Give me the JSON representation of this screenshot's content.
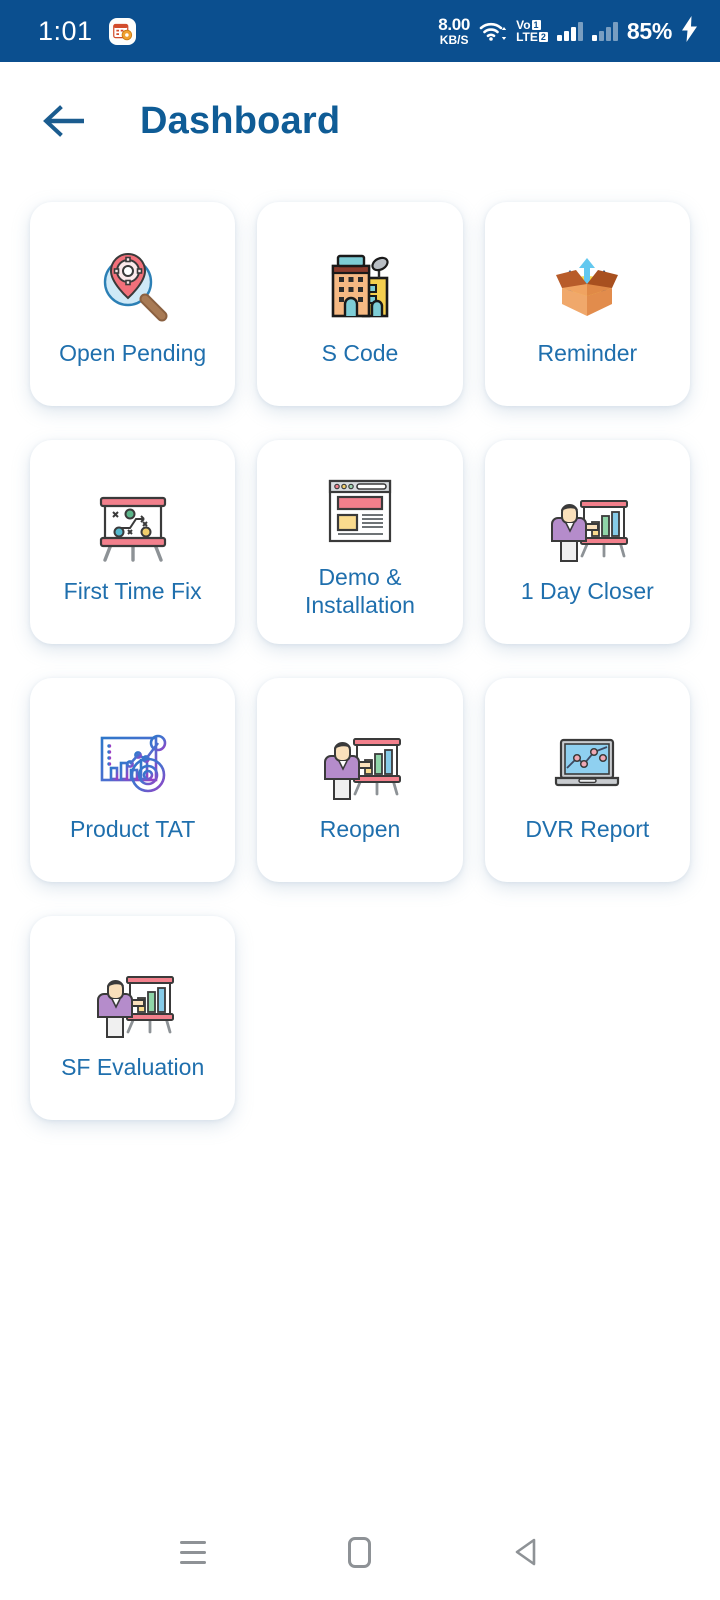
{
  "status_bar": {
    "time": "1:01",
    "notification_icon": "calendar-app-icon",
    "network_speed_value": "8.00",
    "network_speed_unit": "KB/S",
    "wifi_icon": "wifi-icon",
    "volte_top": "Vo",
    "volte_bottom": "LTE",
    "volte_sim1_badge": "1",
    "volte_sim2_badge": "2",
    "signal_sim1_icon": "signal-bars-icon",
    "signal_sim2_icon": "signal-bars-icon",
    "battery_percent": "85%",
    "charging_icon": "charging-bolt-icon",
    "background_color": "#0b4f8f"
  },
  "header": {
    "back_icon": "arrow-left-icon",
    "title": "Dashboard",
    "title_color": "#0f5c96"
  },
  "grid": {
    "label_color": "#1f6fad",
    "card_background": "#ffffff",
    "items": [
      {
        "label": "Open Pending",
        "icon": "magnifier-location-gear-icon"
      },
      {
        "label": "S Code",
        "icon": "office-building-satellite-icon"
      },
      {
        "label": "Reminder",
        "icon": "open-box-arrows-up-icon"
      },
      {
        "label": "First Time Fix",
        "icon": "strategy-board-icon"
      },
      {
        "label": "Demo & Installation",
        "icon": "browser-window-icon"
      },
      {
        "label": "1 Day Closer",
        "icon": "presenter-bar-chart-icon"
      },
      {
        "label": "Product TAT",
        "icon": "analytics-dashboard-icon"
      },
      {
        "label": "Reopen",
        "icon": "presenter-bar-chart-icon"
      },
      {
        "label": "DVR Report",
        "icon": "laptop-line-chart-icon"
      },
      {
        "label": "SF Evaluation",
        "icon": "presenter-bar-chart-icon"
      }
    ]
  },
  "nav_bar": {
    "recents_label": "recents-icon",
    "home_label": "home-icon",
    "back_label": "back-icon",
    "icon_color": "#8e9296"
  }
}
